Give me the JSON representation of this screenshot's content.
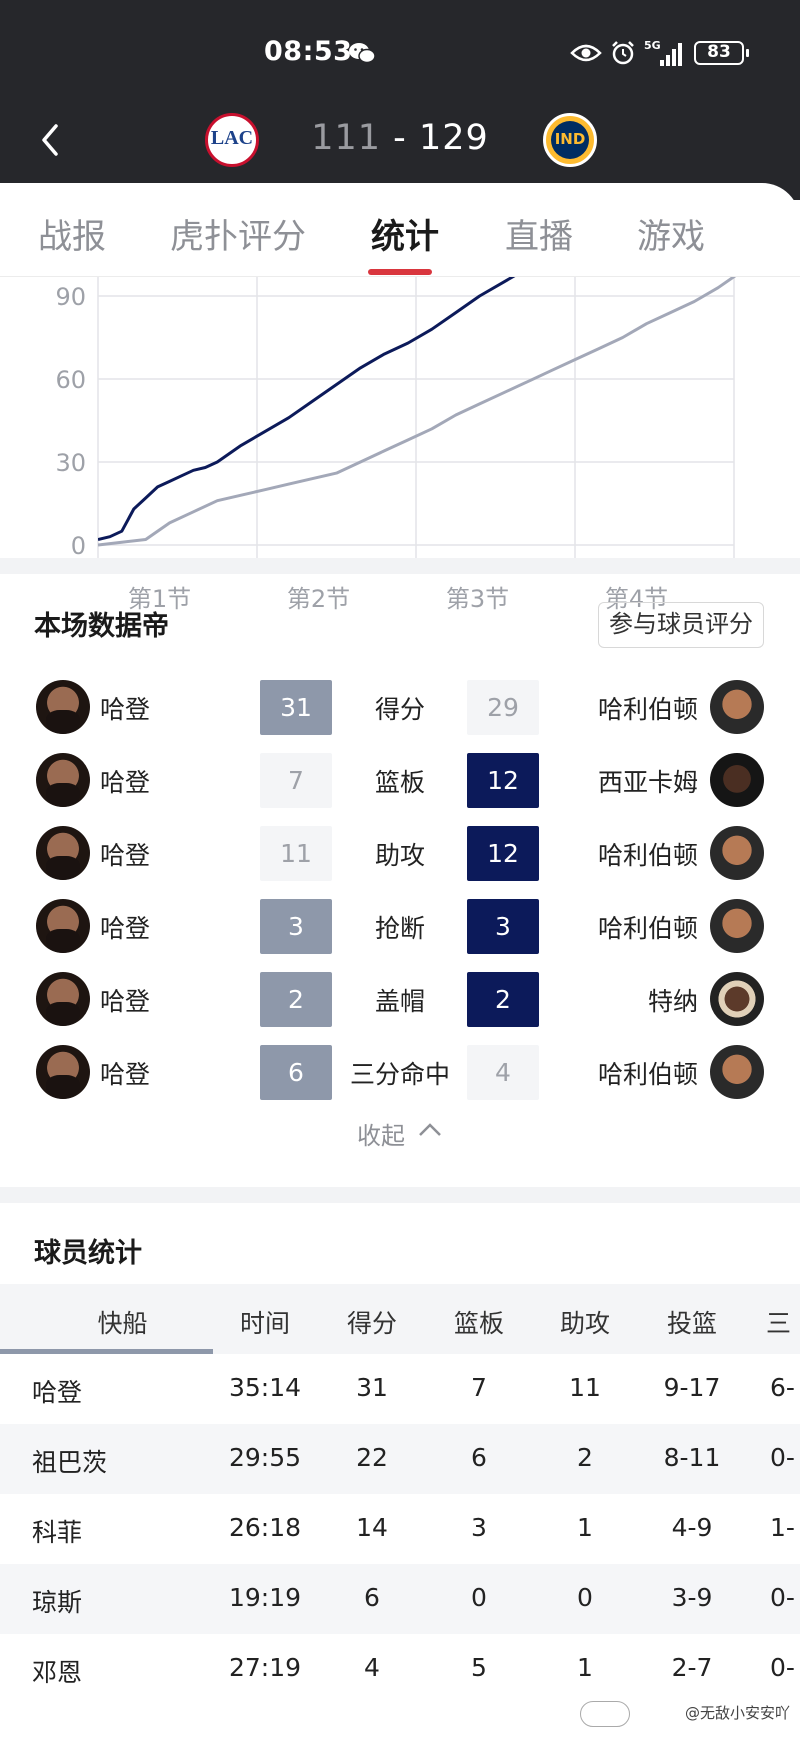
{
  "status_bar": {
    "time": "08:53",
    "network": "5G",
    "battery": "83",
    "icons": [
      "wechat-icon",
      "eye-icon",
      "alarm-icon",
      "signal-icon",
      "battery-icon"
    ]
  },
  "header": {
    "home_team_logo": "LAC",
    "away_team_logo": "IND",
    "home_score": "111",
    "separator": "-",
    "away_score": "129"
  },
  "tabs": [
    "战报",
    "虎扑评分",
    "统计",
    "直播",
    "游戏"
  ],
  "active_tab": "统计",
  "chart_data": {
    "type": "line",
    "y_ticks": [
      "90",
      "60",
      "30",
      "0"
    ],
    "x_labels": [
      "第1节",
      "第2节",
      "第3节",
      "第4节"
    ],
    "ylim": [
      0,
      104
    ],
    "grid": true,
    "series": [
      {
        "color": "#0c1a5a",
        "x": [
          0,
          0.1,
          0.2,
          0.3,
          0.4,
          0.5,
          0.6,
          0.7,
          0.8,
          0.9,
          1.0,
          1.2,
          1.4,
          1.6,
          1.8,
          2.0,
          2.2,
          2.4,
          2.6,
          2.8,
          3.0,
          3.2,
          3.4,
          3.6,
          3.8
        ],
        "y": [
          2,
          3,
          5,
          13,
          17,
          21,
          23,
          25,
          27,
          28,
          30,
          36,
          41,
          46,
          52,
          58,
          64,
          69,
          73,
          78,
          84,
          90,
          95,
          100,
          104
        ]
      },
      {
        "color": "#a3a8b8",
        "x": [
          0,
          0.2,
          0.4,
          0.6,
          0.8,
          1.0,
          1.2,
          1.4,
          1.6,
          1.8,
          2.0,
          2.2,
          2.4,
          2.6,
          2.8,
          3.0,
          3.2,
          3.4,
          3.6,
          3.8,
          4.0,
          4.2,
          4.4,
          4.6,
          4.8,
          5.0,
          5.2,
          5.4,
          5.6
        ],
        "y": [
          0,
          1,
          2,
          8,
          12,
          16,
          18,
          20,
          22,
          24,
          26,
          30,
          34,
          38,
          42,
          47,
          51,
          55,
          59,
          63,
          67,
          71,
          75,
          80,
          84,
          88,
          93,
          99,
          104
        ]
      }
    ]
  },
  "leaders": {
    "title": "本场数据帝",
    "rate_button": "参与球员评分",
    "collapse_label": "收起",
    "rows": [
      {
        "left_player": "哈登",
        "left_value": "31",
        "category": "得分",
        "right_value": "29",
        "right_player": "哈利伯顿",
        "winner": "left"
      },
      {
        "left_player": "哈登",
        "left_value": "7",
        "category": "篮板",
        "right_value": "12",
        "right_player": "西亚卡姆",
        "winner": "right"
      },
      {
        "left_player": "哈登",
        "left_value": "11",
        "category": "助攻",
        "right_value": "12",
        "right_player": "哈利伯顿",
        "winner": "right"
      },
      {
        "left_player": "哈登",
        "left_value": "3",
        "category": "抢断",
        "right_value": "3",
        "right_player": "哈利伯顿",
        "winner": "both"
      },
      {
        "left_player": "哈登",
        "left_value": "2",
        "category": "盖帽",
        "right_value": "2",
        "right_player": "特纳",
        "winner": "both"
      },
      {
        "left_player": "哈登",
        "left_value": "6",
        "category": "三分命中",
        "right_value": "4",
        "right_player": "哈利伯顿",
        "winner": "left"
      }
    ]
  },
  "player_stats": {
    "title": "球员统计",
    "headers": [
      "快船",
      "时间",
      "得分",
      "篮板",
      "助攻",
      "投篮",
      "三"
    ],
    "rows": [
      [
        "哈登",
        "35:14",
        "31",
        "7",
        "11",
        "9-17",
        "6-"
      ],
      [
        "祖巴茨",
        "29:55",
        "22",
        "6",
        "2",
        "8-11",
        "0-"
      ],
      [
        "科菲",
        "26:18",
        "14",
        "3",
        "1",
        "4-9",
        "1-"
      ],
      [
        "琼斯",
        "19:19",
        "6",
        "0",
        "0",
        "3-9",
        "0-"
      ],
      [
        "邓恩",
        "27:19",
        "4",
        "5",
        "1",
        "2-7",
        "0-"
      ]
    ]
  },
  "watermark": "@无敌小安安吖"
}
